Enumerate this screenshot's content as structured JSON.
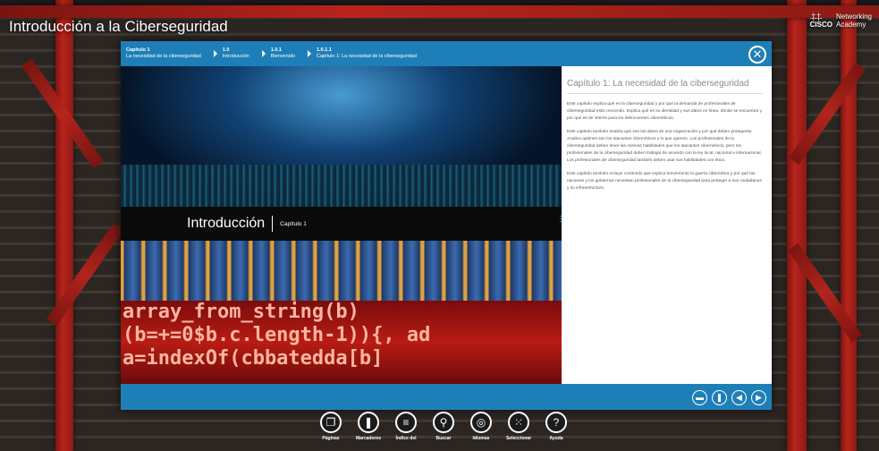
{
  "app": {
    "title": "Introducción a la Ciberseguridad",
    "brand_bars": ".:|:.:|:.",
    "brand_word": "CISCO",
    "brand_line1": "Networking",
    "brand_line2": "Academy"
  },
  "breadcrumb": [
    {
      "num": "Capítulo 1",
      "label": "La necesidad de la ciberseguridad"
    },
    {
      "num": "1.0",
      "label": "Introducción"
    },
    {
      "num": "1.0.1",
      "label": "Bienvenido"
    },
    {
      "num": "1.0.1.1",
      "label": "Capítulo 1: La necesidad de la ciberseguridad"
    }
  ],
  "hero": {
    "title": "Introducción",
    "subtitle": "Capítulo 1",
    "code_line1": "array_from_string(b)",
    "code_line2": "(b=+=0$b.c.length-1)){, ad",
    "code_line3": "a=indexOf(cbbatedda[b]"
  },
  "panel": {
    "title": "Capítulo 1: La necesidad de la ciberseguridad",
    "paragraphs": [
      "Este capítulo explica qué es la ciberseguridad y por qué la demanda de profesionales de ciberseguridad está creciendo. Explica qué es su identidad y sus datos en línea, dónde se encuentra y por qué es de interés para los delincuentes cibernéticos.",
      "Este capítulo también analiza qué son los datos de una organización y por qué deben protegerse. Analiza quiénes son los atacantes cibernéticos y lo que quieren. Los profesionales de la ciberseguridad deben tener las mismas habilidades que los atacantes cibernéticos, pero los profesionales de la ciberseguridad deben trabajar de acuerdo con la ley local, nacional e internacional. Los profesionales de ciberseguridad también deben usar sus habilidades con ética.",
      "Este capítulo también incluye contenido que explica brevemente la guerra cibernética y por qué las naciones y los gobiernos necesitan profesionales de la ciberseguridad para proteger a sus ciudadanos y su infraestructura."
    ]
  },
  "nav": {
    "close": "✕",
    "comment": "▬",
    "bookmark": "❚",
    "prev": "◀",
    "next": "▶"
  },
  "toolbar": [
    {
      "name": "pages-icon",
      "glyph": "❐",
      "label": "Páginas"
    },
    {
      "name": "bookmarks-icon",
      "glyph": "❚",
      "label": "Marcadores"
    },
    {
      "name": "index-icon",
      "glyph": "≡",
      "label": "Índice del"
    },
    {
      "name": "search-icon",
      "glyph": "⚲",
      "label": "Buscar"
    },
    {
      "name": "languages-icon",
      "glyph": "◎",
      "label": "Idiomas"
    },
    {
      "name": "select-icon",
      "glyph": "⁙",
      "label": "Seleccionar"
    },
    {
      "name": "help-icon",
      "glyph": "?",
      "label": "Ayuda"
    }
  ],
  "colors": {
    "accent": "#1e7fb8",
    "girder": "#b8241c",
    "panel_title": "#8a8a8a"
  }
}
